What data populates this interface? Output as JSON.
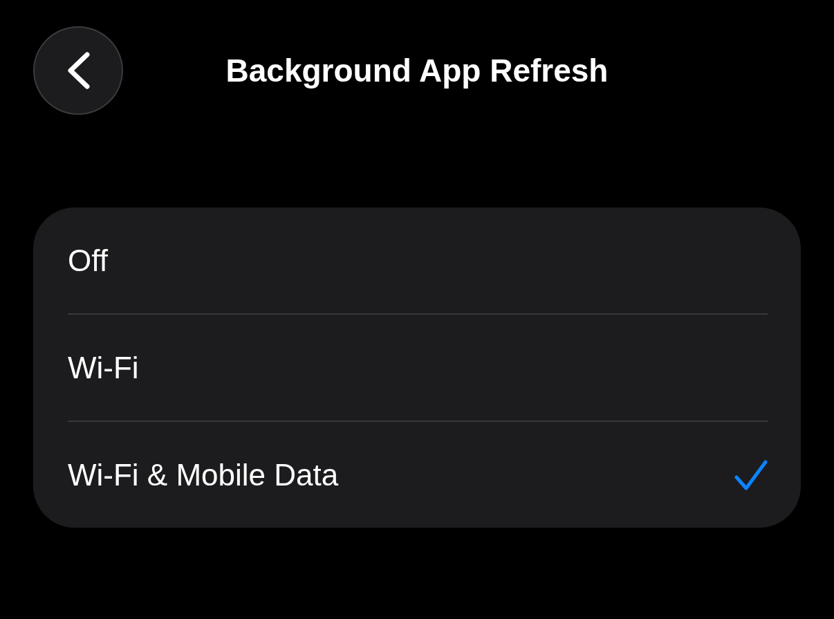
{
  "header": {
    "title": "Background App Refresh"
  },
  "options": [
    {
      "label": "Off",
      "selected": false
    },
    {
      "label": "Wi-Fi",
      "selected": false
    },
    {
      "label": "Wi-Fi & Mobile Data",
      "selected": true
    }
  ]
}
